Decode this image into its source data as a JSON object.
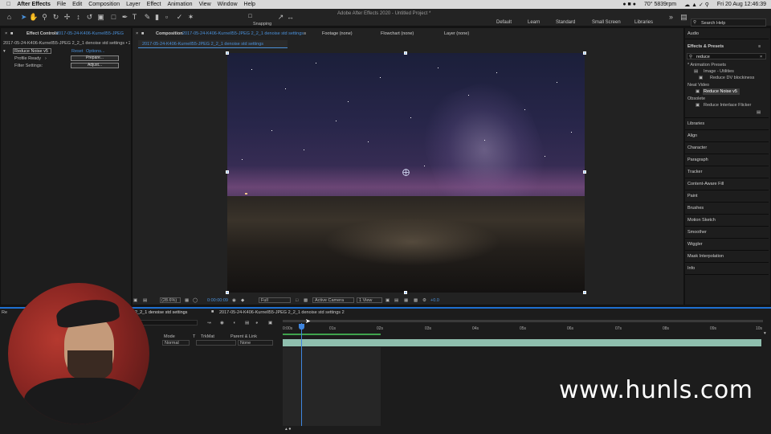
{
  "menubar": {
    "app": "After Effects",
    "items": [
      "File",
      "Edit",
      "Composition",
      "Layer",
      "Effect",
      "Animation",
      "View",
      "Window",
      "Help"
    ],
    "title": "Adobe After Effects 2020 - Untitled Project *",
    "weather": "70° 5839rpm",
    "datetime": "Fri 20 Aug  12:46:39"
  },
  "toolbar": {
    "snapping_label": "Snapping",
    "workspaces": [
      "Default",
      "Learn",
      "Standard",
      "Small Screen",
      "Libraries"
    ],
    "search_placeholder": "Search Help"
  },
  "effect_controls": {
    "tab": "Effect Controls",
    "layer": "2017-05-24-K406-Kurnell55-JPEG",
    "comp_line": "2017-05-24-K406-Kurnell55-JPEG 2_2_1 denoise std settings • 2l",
    "effect_name": "Reduce Noise v5",
    "reset": "Reset",
    "options": "Options...",
    "profile_ready": "Profile Ready",
    "prepare": "Prepare...",
    "filter_settings": "Filter Settings:",
    "adjust": "Adjust..."
  },
  "composition": {
    "tab": "Composition",
    "comp_name": "2017-05-24-K406-Kurnell55-JPEG 2_2_1 denoise std settings",
    "subtab": "2017-05-24-K406-Kurnell55-JPEG 2_2_1 denoise std settings",
    "other_tabs": [
      "Footage (none)",
      "Flowchart (none)",
      "Layer (none)"
    ],
    "zoom": "(28.6%)",
    "timecode": "0:00:00:09",
    "resolution": "Full",
    "camera": "Active Camera",
    "views": "1 View",
    "exposure": "+0.0"
  },
  "effects_presets": {
    "tab": "Audio",
    "title": "Effects & Presets",
    "search": "reduce",
    "tree": [
      {
        "label": "* Animation Presets",
        "indent": 0
      },
      {
        "label": "Image - Utilities",
        "indent": 1
      },
      {
        "label": "Reduce DV blockiness",
        "indent": 2
      },
      {
        "label": "Neat Video",
        "indent": 0
      },
      {
        "label": "Reduce Noise v5",
        "indent": 2
      },
      {
        "label": "Obsolete",
        "indent": 0
      },
      {
        "label": "Reduce Interlace Flicker",
        "indent": 2
      }
    ]
  },
  "right_panels": [
    "Libraries",
    "Align",
    "Character",
    "Paragraph",
    "Tracker",
    "Content-Aware Fill",
    "Paint",
    "Brushes",
    "Motion Sketch",
    "Smoother",
    "Wiggler",
    "Mask Interpolation",
    "Info"
  ],
  "timeline": {
    "tab1": "2_2_1 denoise std settings",
    "tab2": "2017-05-24-K406-Kurnell55-JPEG 2_2_1 denoise std settings 2",
    "mode_header": "Mode",
    "t_header": "T",
    "trkmat_header": "TrkMat",
    "parent_header": "Parent & Link",
    "mode_value": "Normal",
    "parent_value": "None",
    "ruler": [
      "0:00s",
      "01s",
      "02s",
      "03s",
      "04s",
      "05s",
      "06s",
      "07s",
      "08s",
      "09s",
      "10s"
    ]
  },
  "watermark": "www.hunls.com",
  "colors": {
    "accent": "#4a90d9",
    "timeline_border": "#1e6fd0",
    "layer_bar": "#8fbfae",
    "work_area": "#3fa34d"
  }
}
